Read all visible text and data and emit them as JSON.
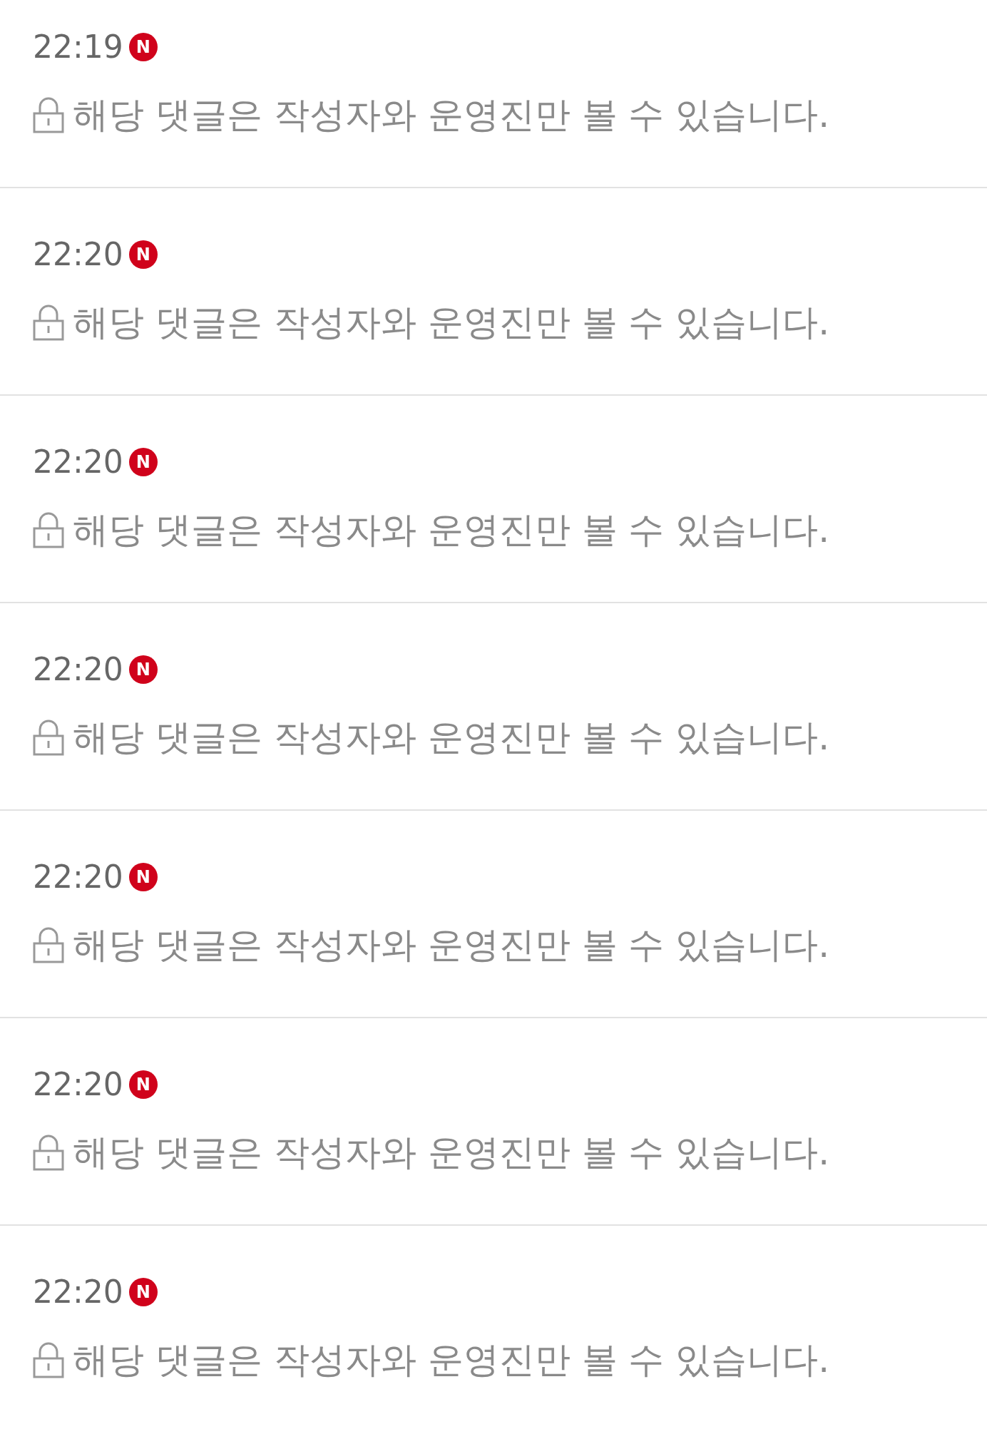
{
  "comments": [
    {
      "time": "22:19",
      "badge": "N",
      "message": "해당 댓글은 작성자와 운영진만 볼 수 있습니다."
    },
    {
      "time": "22:20",
      "badge": "N",
      "message": "해당 댓글은 작성자와 운영진만 볼 수 있습니다."
    },
    {
      "time": "22:20",
      "badge": "N",
      "message": "해당 댓글은 작성자와 운영진만 볼 수 있습니다."
    },
    {
      "time": "22:20",
      "badge": "N",
      "message": "해당 댓글은 작성자와 운영진만 볼 수 있습니다."
    },
    {
      "time": "22:20",
      "badge": "N",
      "message": "해당 댓글은 작성자와 운영진만 볼 수 있습니다."
    },
    {
      "time": "22:20",
      "badge": "N",
      "message": "해당 댓글은 작성자와 운영진만 볼 수 있습니다."
    },
    {
      "time": "22:20",
      "badge": "N",
      "message": "해당 댓글은 작성자와 운영진만 볼 수 있습니다."
    }
  ]
}
